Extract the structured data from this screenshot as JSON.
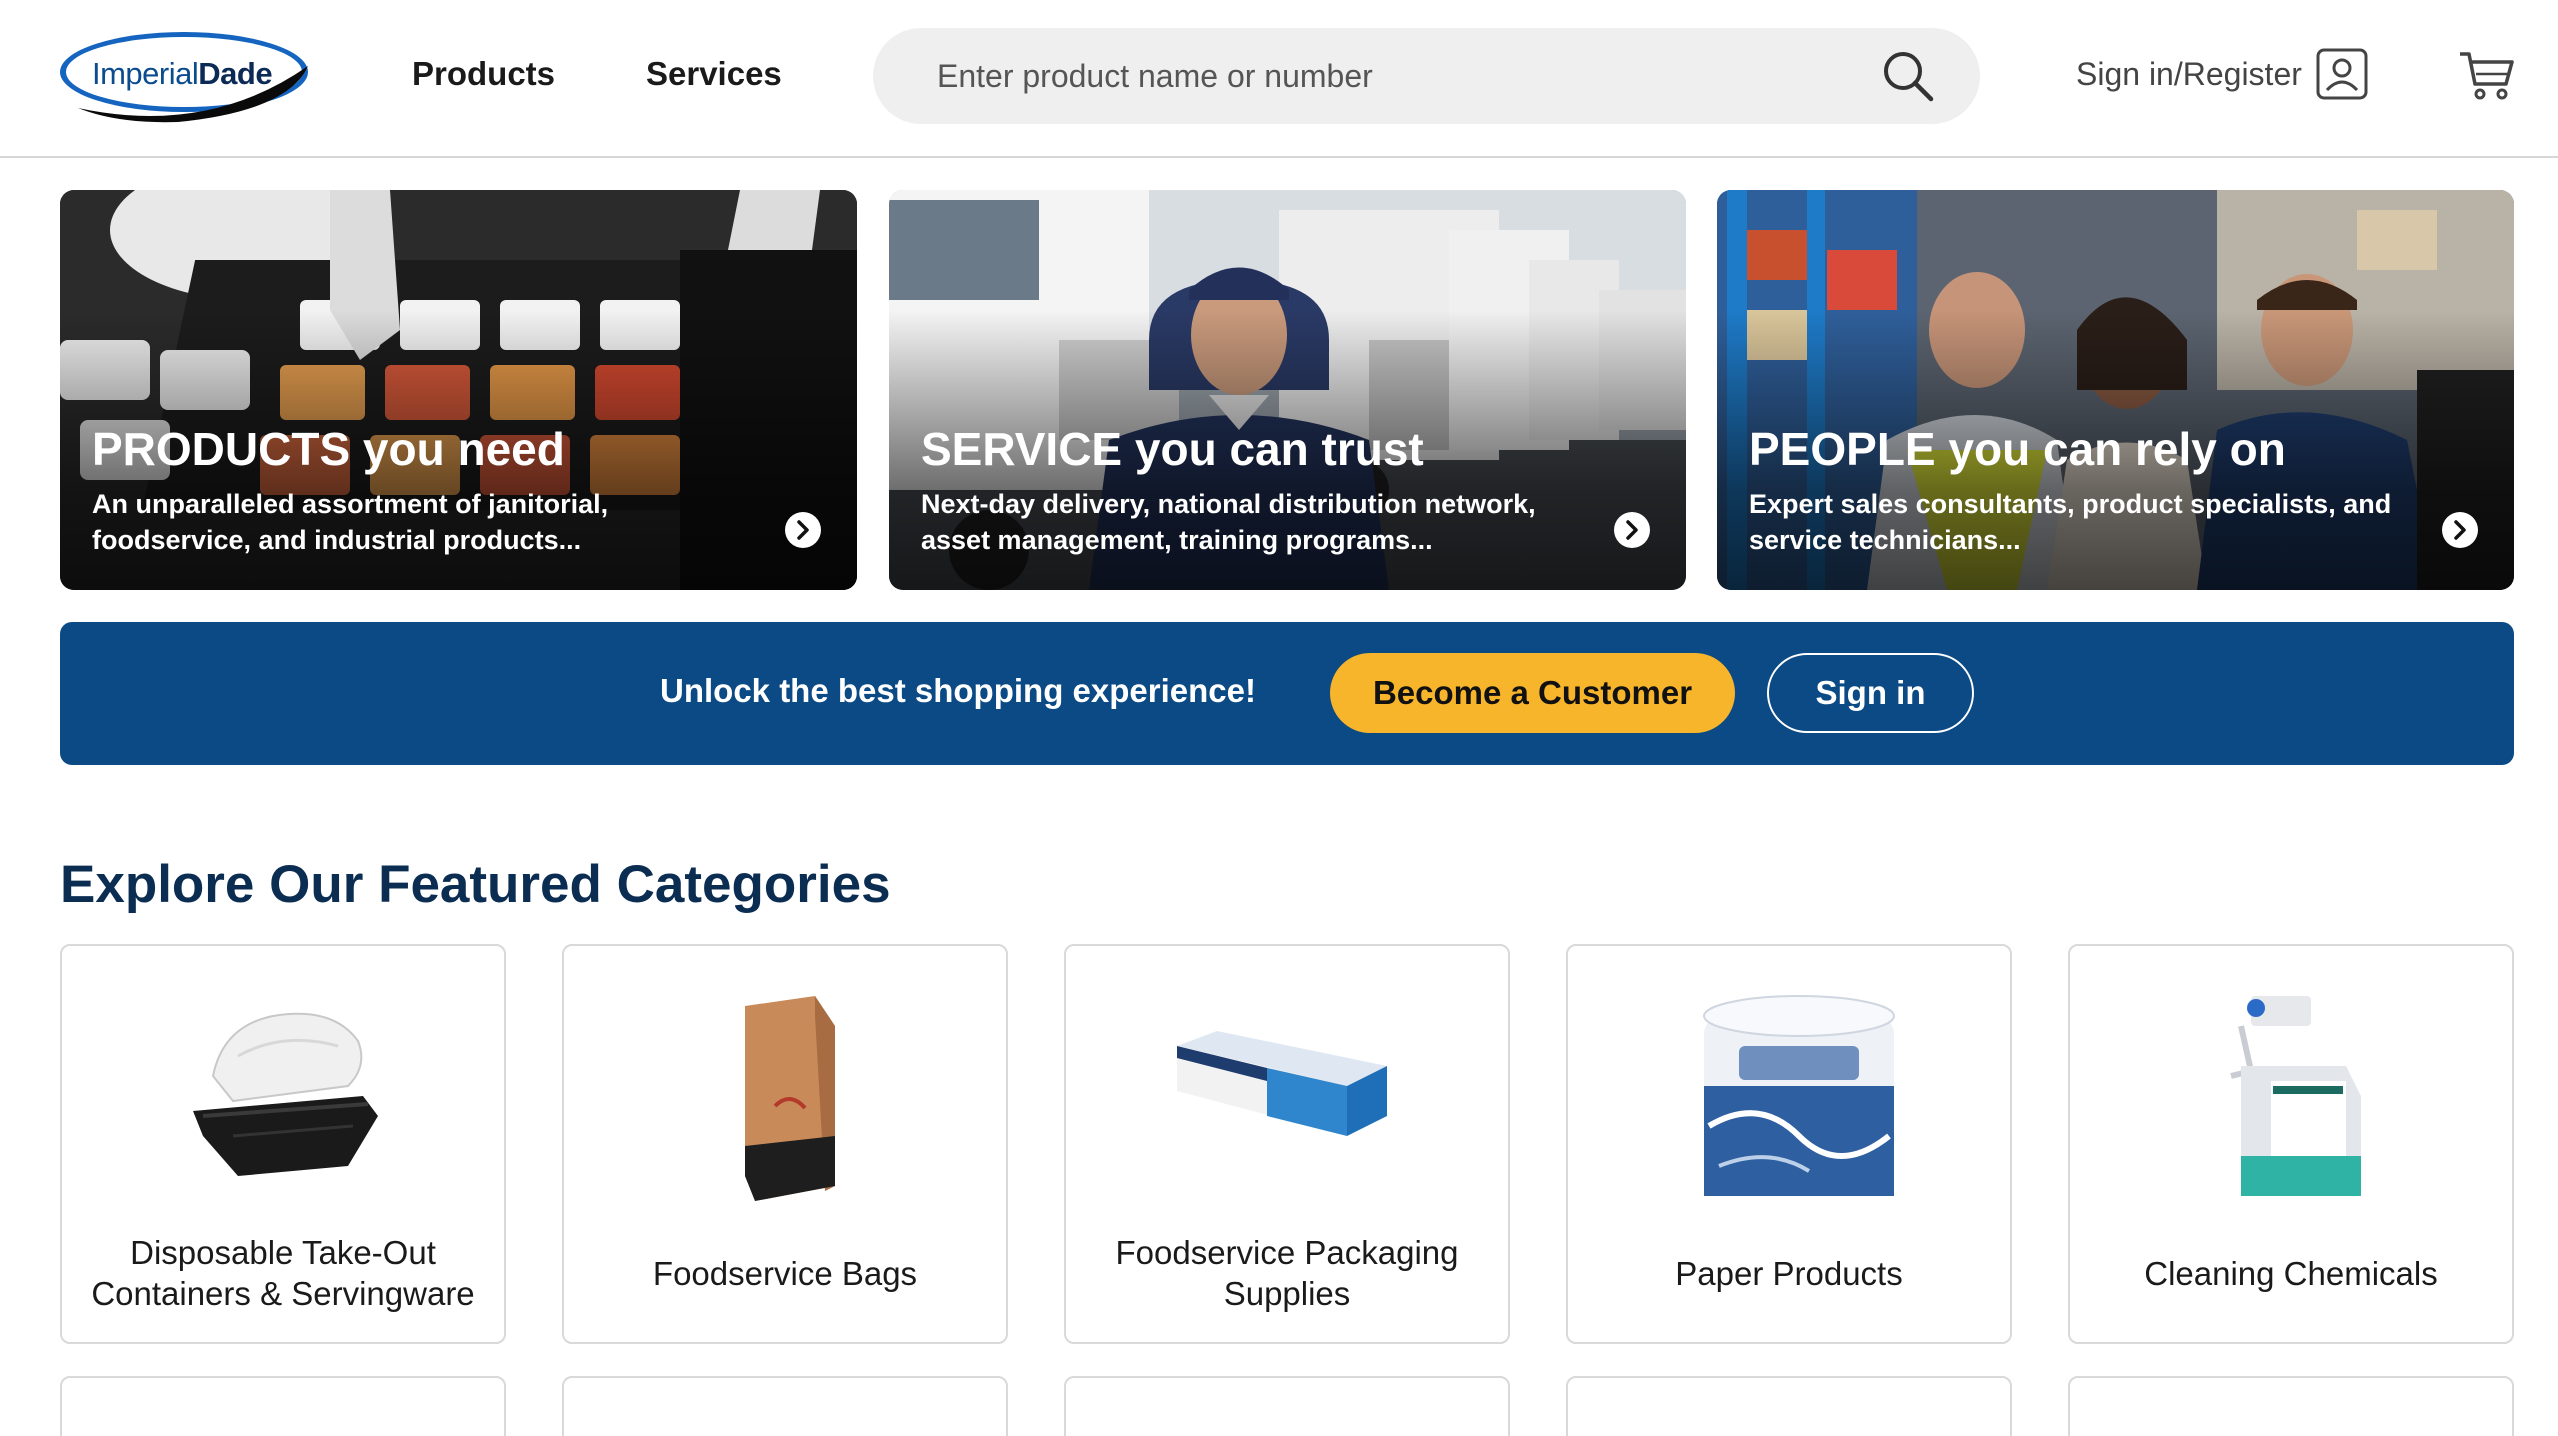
{
  "header": {
    "logo_imperial": "Imperial",
    "logo_dade": "Dade",
    "nav": {
      "products": "Products",
      "services": "Services"
    },
    "search": {
      "placeholder": "Enter product name or number"
    },
    "signin_label": "Sign in/Register"
  },
  "heroes": [
    {
      "title_caps": "PRODUCTS",
      "title_rest": " you need",
      "desc": "An unparalleled assortment of janitorial, foodservice, and industrial products..."
    },
    {
      "title_caps": "SERVICE",
      "title_rest": " you can trust",
      "desc": "Next-day delivery, national distribution network, asset management, training programs..."
    },
    {
      "title_caps": "PEOPLE",
      "title_rest": " you can rely on",
      "desc": "Expert sales consultants, product specialists, and service technicians..."
    }
  ],
  "banner": {
    "text": "Unlock the best shopping experience!",
    "become_label": "Become a Customer",
    "signin_label": "Sign in",
    "bg_color": "#0b4a85",
    "accent_color": "#f7b52c"
  },
  "categories": {
    "title": "Explore Our Featured Categories",
    "items": [
      {
        "label": "Disposable Take-Out Containers & Servingware",
        "icon": "takeout-container-icon"
      },
      {
        "label": "Foodservice Bags",
        "icon": "paper-bag-icon"
      },
      {
        "label": "Foodservice Packaging Supplies",
        "icon": "foil-box-icon"
      },
      {
        "label": "Paper Products",
        "icon": "toilet-paper-icon"
      },
      {
        "label": "Cleaning Chemicals",
        "icon": "chemical-jug-icon"
      }
    ]
  }
}
